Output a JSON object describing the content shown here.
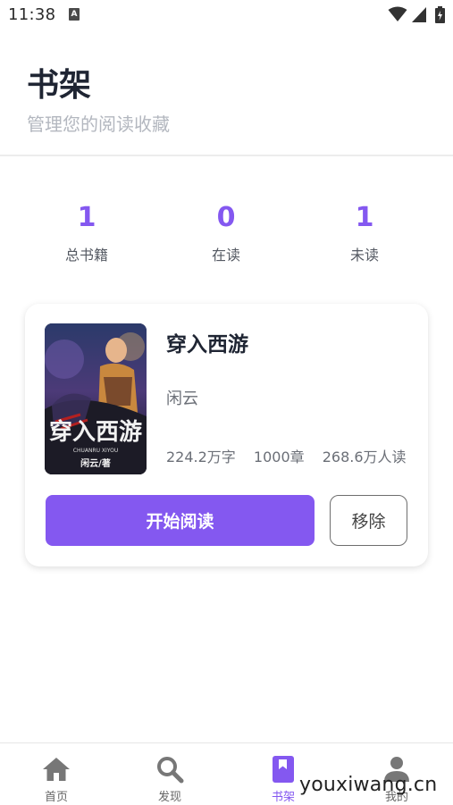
{
  "status_bar": {
    "time": "11:38",
    "notification_letter": "A"
  },
  "header": {
    "title": "书架",
    "subtitle": "管理您的阅读收藏"
  },
  "stats": [
    {
      "value": "1",
      "label": "总书籍"
    },
    {
      "value": "0",
      "label": "在读"
    },
    {
      "value": "1",
      "label": "未读"
    }
  ],
  "book": {
    "title": "穿入西游",
    "author": "闲云",
    "word_count": "224.2万字",
    "chapters": "1000章",
    "readers": "268.6万人读",
    "cover_text": {
      "title": "穿入西游",
      "subtitle": "CHUANRU XIYOU",
      "author": "闲云/著"
    },
    "start_button": "开始阅读",
    "remove_button": "移除"
  },
  "bottom_nav": [
    {
      "label": "首页",
      "icon": "home-icon"
    },
    {
      "label": "发现",
      "icon": "search-icon"
    },
    {
      "label": "书架",
      "icon": "bookshelf-icon",
      "active": true
    },
    {
      "label": "我的",
      "icon": "profile-icon"
    }
  ],
  "watermark": "youxiwang.cn",
  "colors": {
    "accent": "#8458f0",
    "title": "#1f2533",
    "muted": "#b3b7bf",
    "inactive_icon": "#777777"
  }
}
